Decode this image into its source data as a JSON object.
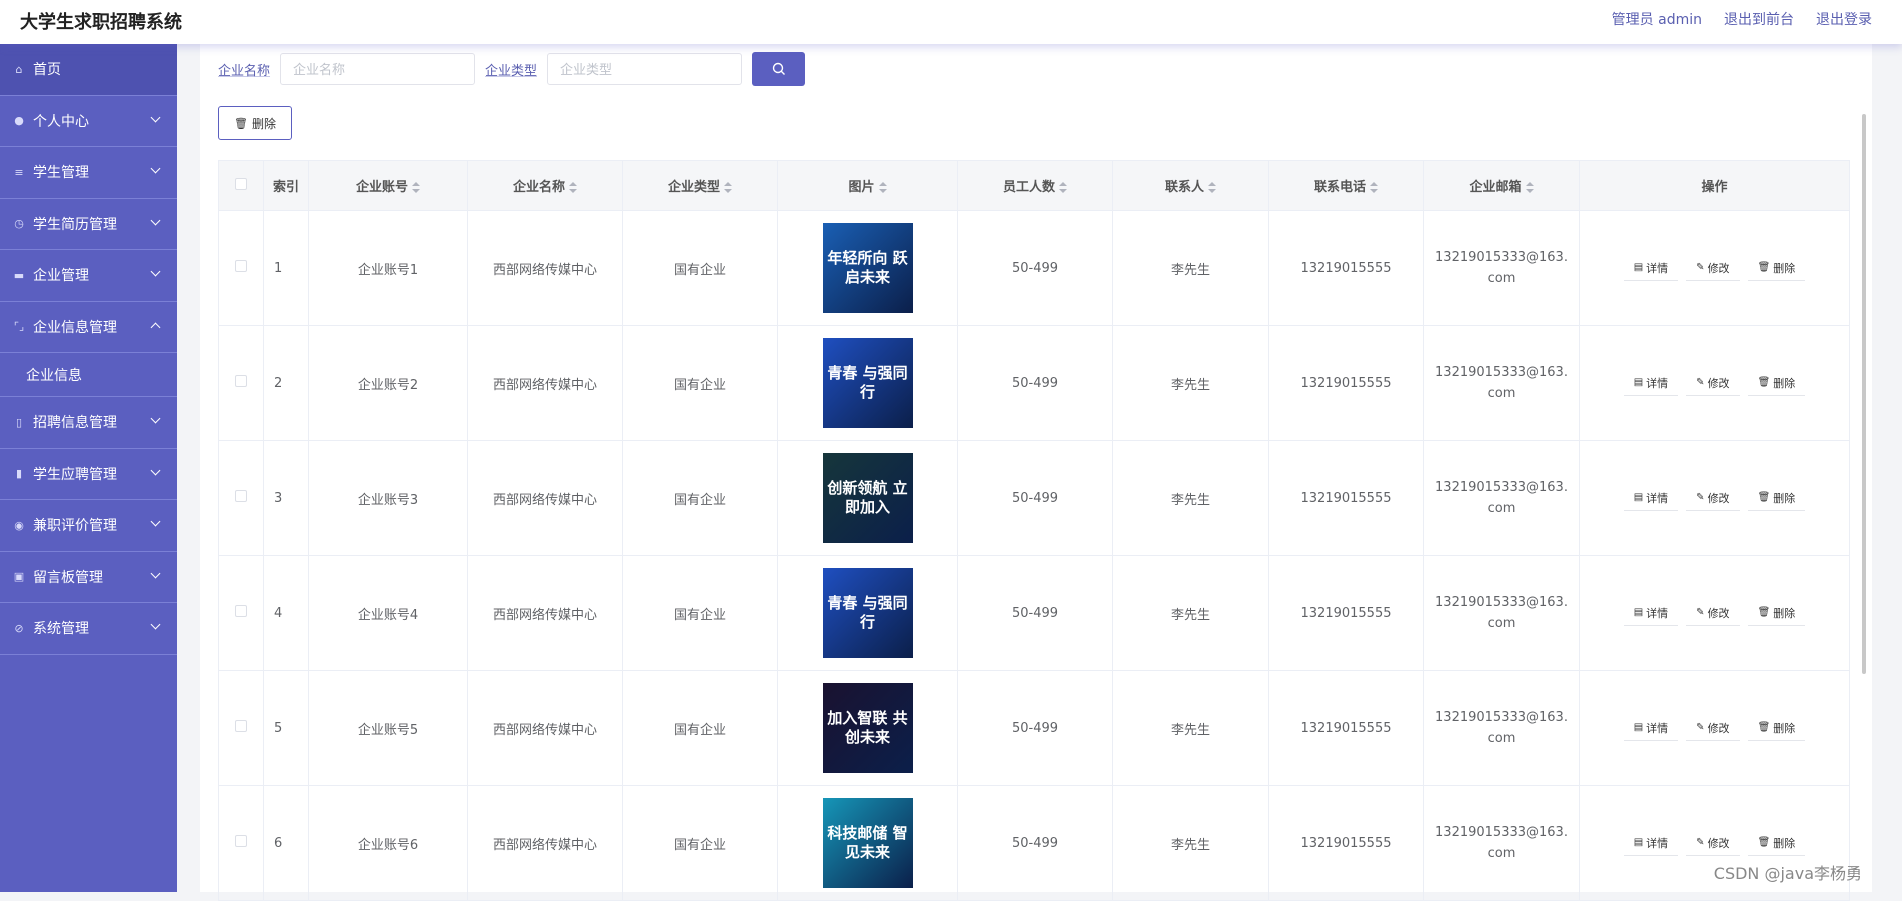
{
  "header": {
    "app_title": "大学生求职招聘系统",
    "user_label": "管理员 admin",
    "back_label": "退出到前台",
    "logout_label": "退出登录"
  },
  "sidebar": {
    "items": [
      {
        "label": "首页",
        "icon": "home-icon"
      },
      {
        "label": "个人中心",
        "icon": "user-icon"
      },
      {
        "label": "学生管理",
        "icon": "menu-icon"
      },
      {
        "label": "学生简历管理",
        "icon": "clock-icon"
      },
      {
        "label": "企业管理",
        "icon": "building-icon"
      },
      {
        "label": "企业信息管理",
        "icon": "frame-icon"
      },
      {
        "label": "招聘信息管理",
        "icon": "phone-icon"
      },
      {
        "label": "学生应聘管理",
        "icon": "bar-chart-icon"
      },
      {
        "label": "兼职评价管理",
        "icon": "location-icon"
      },
      {
        "label": "留言板管理",
        "icon": "clipboard-icon"
      },
      {
        "label": "系统管理",
        "icon": "settings-icon"
      }
    ],
    "sub_item": "企业信息"
  },
  "search": {
    "name_label": "企业名称",
    "name_placeholder": "企业名称",
    "type_label": "企业类型",
    "type_placeholder": "企业类型"
  },
  "toolbar": {
    "delete_label": "删除"
  },
  "table": {
    "headers": [
      "索引",
      "企业账号",
      "企业名称",
      "企业类型",
      "图片",
      "员工人数",
      "联系人",
      "联系电话",
      "企业邮箱",
      "操作"
    ],
    "rows": [
      {
        "index": "1",
        "account": "企业账号1",
        "name": "西部网络传媒中心",
        "type": "国有企业",
        "image_text": "年轻所向 跃启未来",
        "image_color": "#1a5fb4",
        "staff": "50-499",
        "contact": "李先生",
        "phone": "13219015555",
        "email": "13219015333@163.com"
      },
      {
        "index": "2",
        "account": "企业账号2",
        "name": "西部网络传媒中心",
        "type": "国有企业",
        "image_text": "青春 与强同行",
        "image_color": "#1f4fc0",
        "staff": "50-499",
        "contact": "李先生",
        "phone": "13219015555",
        "email": "13219015333@163.com"
      },
      {
        "index": "3",
        "account": "企业账号3",
        "name": "西部网络传媒中心",
        "type": "国有企业",
        "image_text": "创新领航 立即加入",
        "image_color": "#16363b",
        "staff": "50-499",
        "contact": "李先生",
        "phone": "13219015555",
        "email": "13219015333@163.com"
      },
      {
        "index": "4",
        "account": "企业账号4",
        "name": "西部网络传媒中心",
        "type": "国有企业",
        "image_text": "青春 与强同行",
        "image_color": "#1f4fc0",
        "staff": "50-499",
        "contact": "李先生",
        "phone": "13219015555",
        "email": "13219015333@163.com"
      },
      {
        "index": "5",
        "account": "企业账号5",
        "name": "西部网络传媒中心",
        "type": "国有企业",
        "image_text": "加入智联 共创未来",
        "image_color": "#1a1230",
        "staff": "50-499",
        "contact": "李先生",
        "phone": "13219015555",
        "email": "13219015333@163.com"
      },
      {
        "index": "6",
        "account": "企业账号6",
        "name": "西部网络传媒中心",
        "type": "国有企业",
        "image_text": "科技邮储 智见未来",
        "image_color": "#1696b8",
        "staff": "50-499",
        "contact": "李先生",
        "phone": "13219015555",
        "email": "13219015333@163.com"
      }
    ],
    "ops": {
      "detail": "详情",
      "edit": "修改",
      "delete": "删除"
    }
  },
  "watermark": "CSDN @java李杨勇"
}
